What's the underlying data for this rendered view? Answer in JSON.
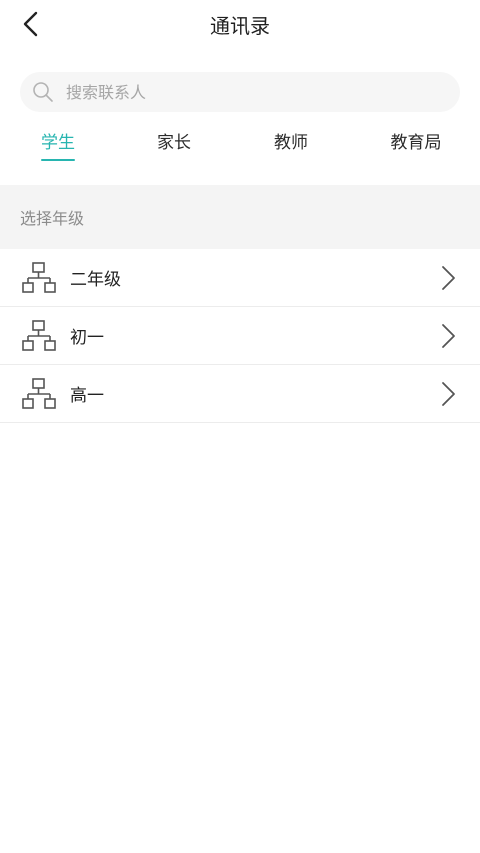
{
  "header": {
    "title": "通讯录",
    "back_icon": "chevron-left-icon"
  },
  "search": {
    "placeholder": "搜索联系人",
    "value": "",
    "icon": "search-icon"
  },
  "tabs": [
    {
      "label": "学生",
      "active": true
    },
    {
      "label": "家长",
      "active": false
    },
    {
      "label": "教师",
      "active": false
    },
    {
      "label": "教育局",
      "active": false
    }
  ],
  "section": {
    "title": "选择年级"
  },
  "grades": [
    {
      "label": "二年级",
      "icon": "org-chart-icon"
    },
    {
      "label": "初一",
      "icon": "org-chart-icon"
    },
    {
      "label": "高一",
      "icon": "org-chart-icon"
    }
  ],
  "colors": {
    "accent": "#27b5b0",
    "section_bg": "#f4f4f4",
    "muted_text": "#8c8c8c"
  }
}
